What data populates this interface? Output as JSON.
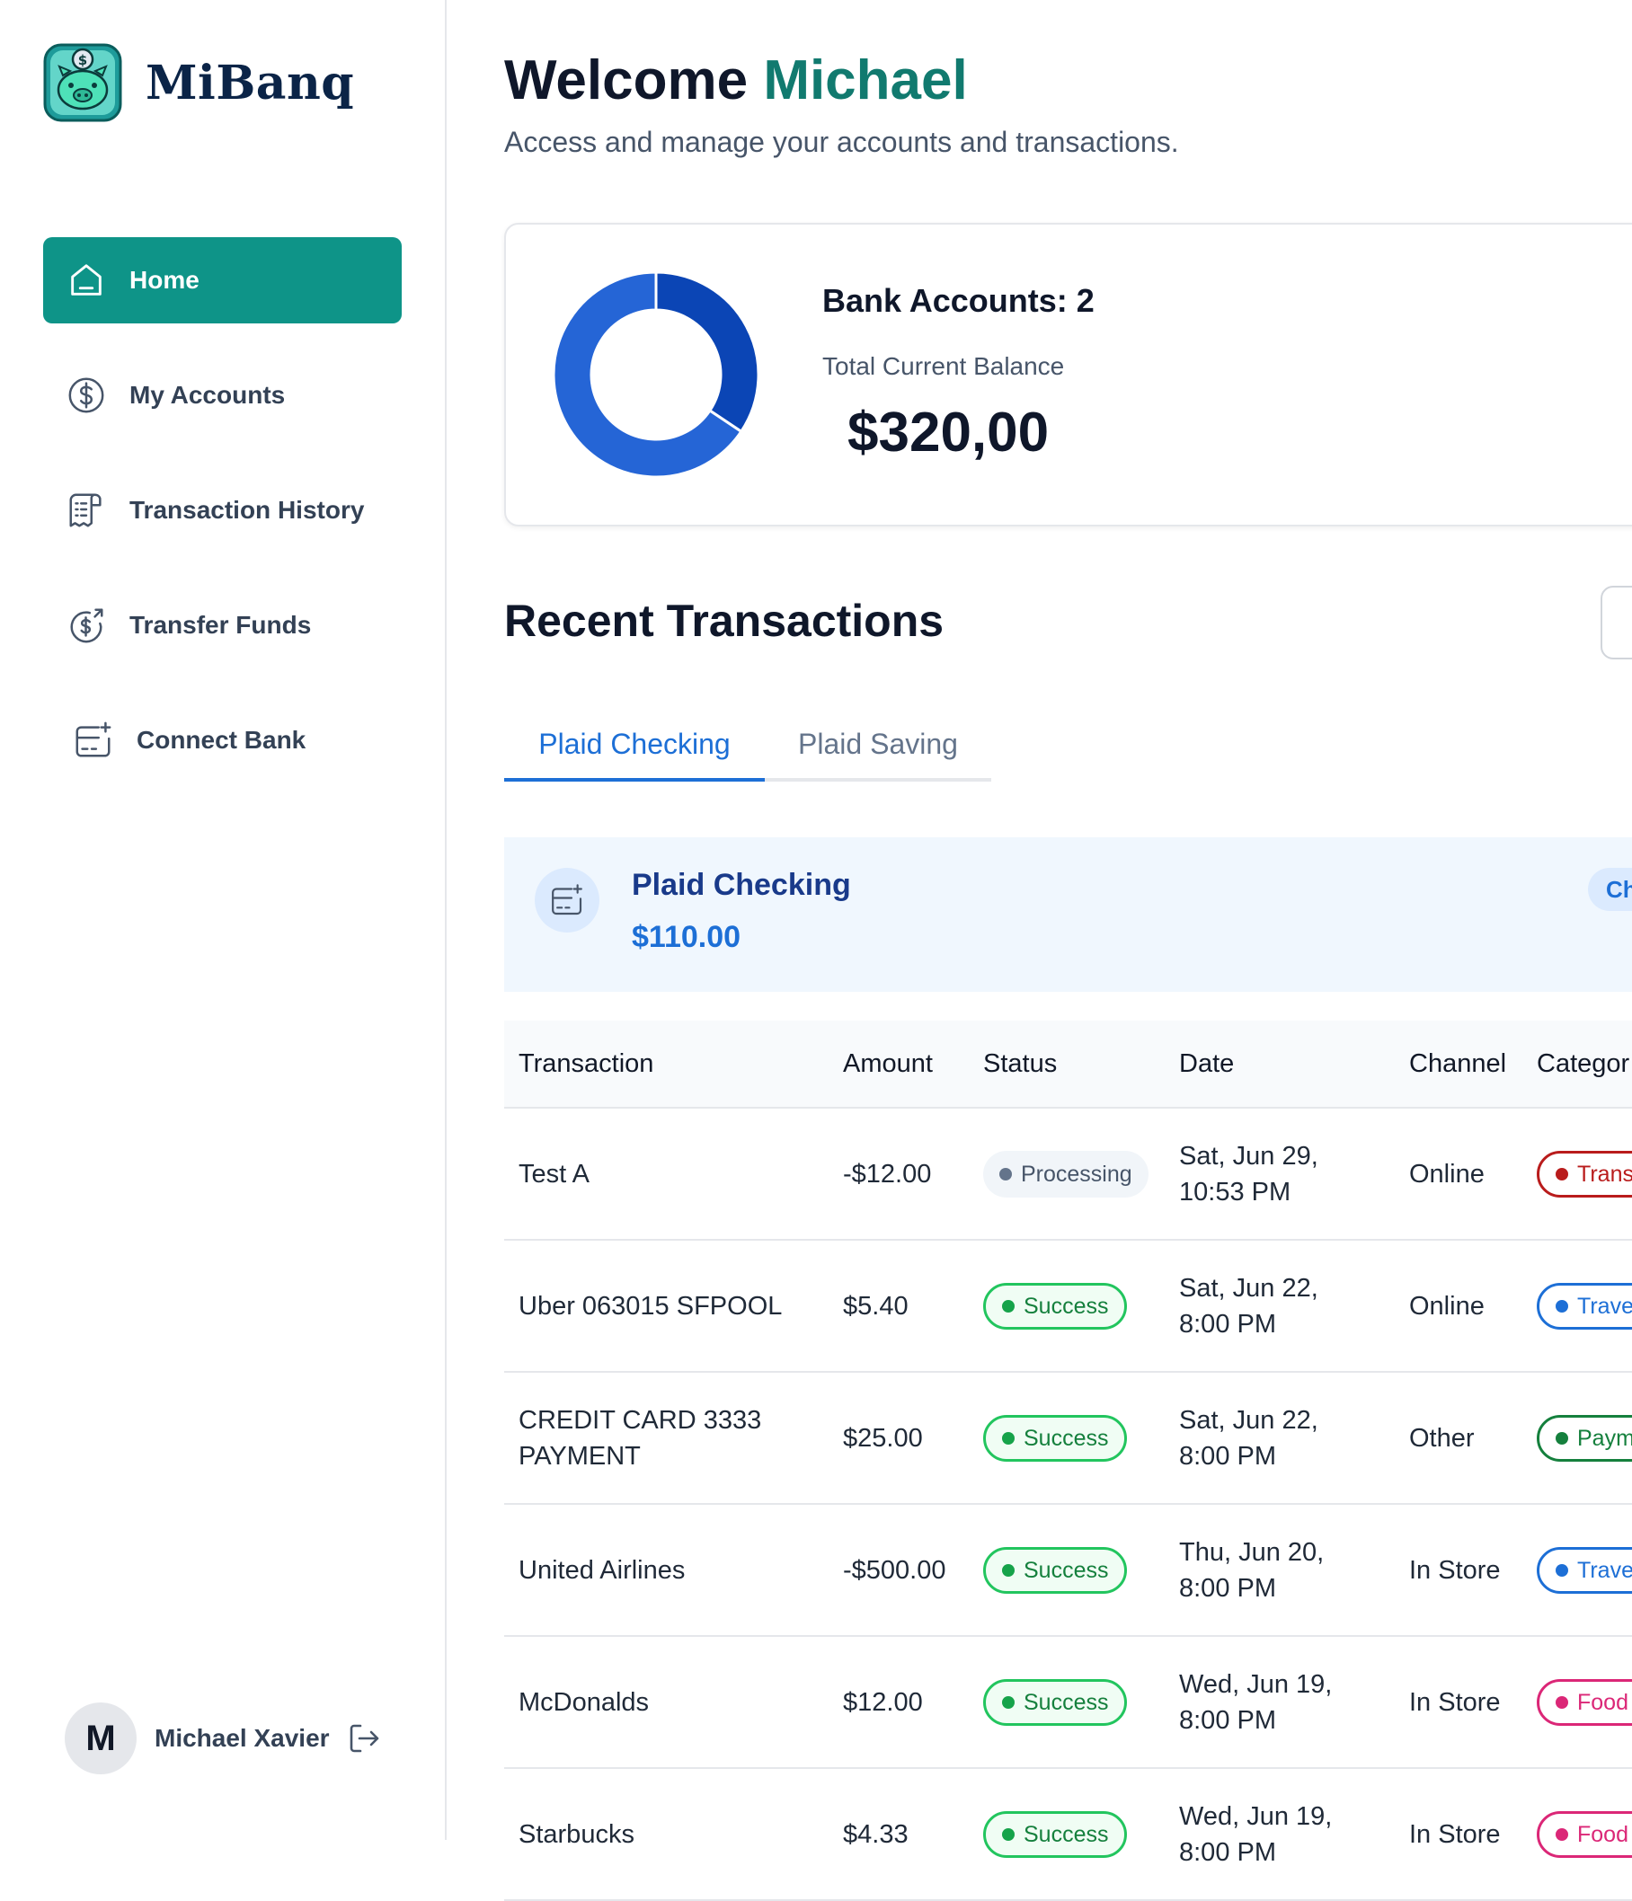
{
  "brand": {
    "name": "MiBanq",
    "logo_icon": "piggy-bank-icon"
  },
  "sidebar": {
    "items": [
      {
        "label": "Home",
        "icon": "home-icon",
        "active": true
      },
      {
        "label": "My Accounts",
        "icon": "dollar-circle-icon",
        "active": false
      },
      {
        "label": "Transaction History",
        "icon": "receipt-icon",
        "active": false
      },
      {
        "label": "Transfer Funds",
        "icon": "money-send-icon",
        "active": false
      },
      {
        "label": "Connect Bank",
        "icon": "connect-bank-icon",
        "active": false
      }
    ],
    "user": {
      "initial": "M",
      "name": "Michael Xavier",
      "logout_icon": "logout-icon"
    }
  },
  "header": {
    "welcome": "Welcome",
    "user_first_name": "Michael",
    "subtitle": "Access and manage your accounts and transactions."
  },
  "balance_card": {
    "bank_accounts": "Bank Accounts: 2",
    "total_label": "Total Current Balance",
    "total_value": "$320,00",
    "donut_fractions": [
      0.34375,
      0.65625
    ],
    "donut_colors": [
      "#0b45b5",
      "#2565d6"
    ]
  },
  "recent": {
    "title": "Recent Transactions",
    "tabs": [
      {
        "label": "Plaid Checking",
        "active": true
      },
      {
        "label": "Plaid Saving",
        "active": false
      }
    ],
    "account": {
      "name": "Plaid Checking",
      "balance": "$110.00",
      "badge": "Ch"
    }
  },
  "table": {
    "headers": [
      "Transaction",
      "Amount",
      "Status",
      "Date",
      "Channel",
      "Categor"
    ],
    "rows": [
      {
        "name": "Test A",
        "amount": "-$12.00",
        "status": "Processing",
        "date": "Sat, Jun 29,\n10:53 PM",
        "channel": "Online",
        "category": "Transf",
        "cat_color": "#b91c1c"
      },
      {
        "name": "Uber 063015 SFPOOL",
        "amount": "$5.40",
        "status": "Success",
        "date": "Sat, Jun 22,\n8:00 PM",
        "channel": "Online",
        "category": "Travel",
        "cat_color": "#1d6fd6"
      },
      {
        "name": "CREDIT CARD 3333\nPAYMENT",
        "amount": "$25.00",
        "status": "Success",
        "date": "Sat, Jun 22,\n8:00 PM",
        "channel": "Other",
        "category": "Payme",
        "cat_color": "#15803d"
      },
      {
        "name": "United Airlines",
        "amount": "-$500.00",
        "status": "Success",
        "date": "Thu, Jun 20,\n8:00 PM",
        "channel": "In Store",
        "category": "Travel",
        "cat_color": "#1d6fd6"
      },
      {
        "name": "McDonalds",
        "amount": "$12.00",
        "status": "Success",
        "date": "Wed, Jun 19,\n8:00 PM",
        "channel": "In Store",
        "category": "Food a",
        "cat_color": "#db2777"
      },
      {
        "name": "Starbucks",
        "amount": "$4.33",
        "status": "Success",
        "date": "Wed, Jun 19,\n8:00 PM",
        "channel": "In Store",
        "category": "Food a",
        "cat_color": "#db2777"
      }
    ]
  },
  "colors": {
    "accent": "#0e9488",
    "blue": "#1d6fd6",
    "success": "#22c55e"
  }
}
